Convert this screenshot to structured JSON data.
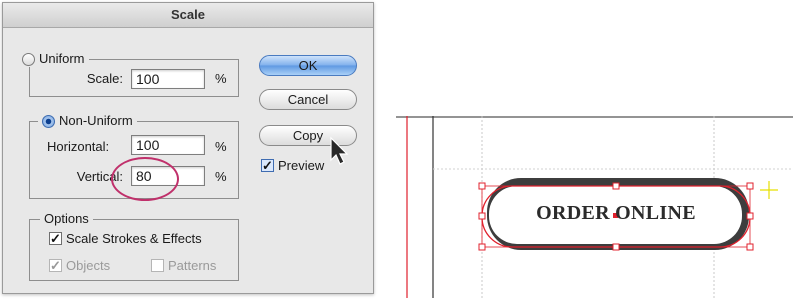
{
  "dialog": {
    "title": "Scale",
    "uniform": {
      "label": "Uniform",
      "scale_label": "Scale:",
      "scale_value": "100",
      "unit": "%"
    },
    "non_uniform": {
      "label": "Non-Uniform",
      "horizontal_label": "Horizontal:",
      "horizontal_value": "100",
      "vertical_label": "Vertical:",
      "vertical_value": "80",
      "unit": "%"
    },
    "options": {
      "label": "Options",
      "scale_strokes_label": "Scale Strokes & Effects",
      "objects_label": "Objects",
      "patterns_label": "Patterns"
    },
    "buttons": {
      "ok": "OK",
      "cancel": "Cancel",
      "copy": "Copy"
    },
    "preview_label": "Preview"
  },
  "canvas": {
    "artwork_text": "ORDER ONLINE"
  },
  "colors": {
    "annotation": "#c0306b",
    "selection": "#e0202c",
    "guide": "#c8c8c8",
    "shape_fill": "#3d3d3d"
  }
}
